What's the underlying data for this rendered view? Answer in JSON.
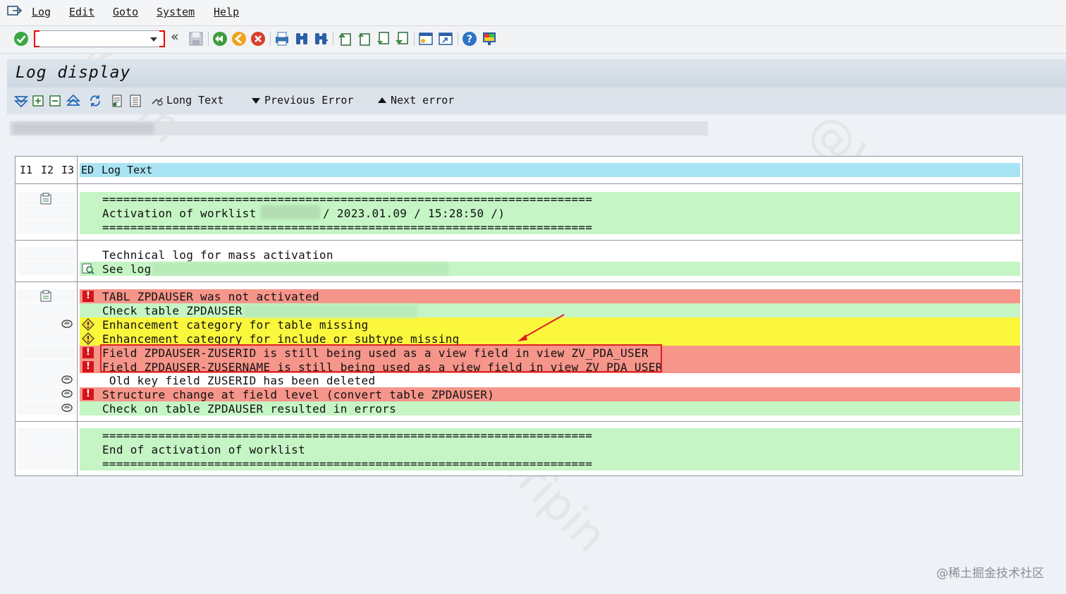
{
  "menu": {
    "items": [
      "Log",
      "Edit",
      "Goto",
      "System",
      "Help"
    ]
  },
  "toolbar": {
    "command_value": "",
    "icons": [
      "enter-icon",
      "back-double-arrow-icon",
      "save-icon",
      "back-icon",
      "exit-icon",
      "cancel-icon",
      "print-icon",
      "find-icon",
      "find-next-icon",
      "first-page-icon",
      "previous-page-icon",
      "next-page-icon",
      "last-page-icon",
      "create-session-icon",
      "shortcut-icon",
      "help-icon",
      "layout-menu-icon"
    ]
  },
  "page": {
    "title": "Log display"
  },
  "app_toolbar": {
    "long_text": "Long Text",
    "previous_error": "Previous Error",
    "next_error": "Next error"
  },
  "table": {
    "headers": [
      "I1",
      "I2",
      "I3",
      "ED",
      "Log Text"
    ],
    "rows": [
      {
        "text": "======================================================================",
        "color": "green"
      },
      {
        "text": "Activation of worklist",
        "suffix": "/ 2023.01.09 / 15:28:50 /)",
        "color": "green"
      },
      {
        "text": "======================================================================",
        "color": "green"
      },
      {
        "text": "Technical log for mass activation",
        "color": "white"
      },
      {
        "text": "See log",
        "color": "green"
      },
      {
        "text": "TABL ZPDAUSER was not activated",
        "color": "red"
      },
      {
        "text": "Check table ZPDAUSER",
        "color": "green"
      },
      {
        "text": "Enhancement category for table missing",
        "color": "yellow"
      },
      {
        "text": "Enhancement category for include or subtype missing",
        "color": "yellow"
      },
      {
        "text": "Field ZPDAUSER-ZUSERID is still being used as a view field in view ZV_PDA_USER",
        "color": "red"
      },
      {
        "text": "Field ZPDAUSER-ZUSERNAME is still being used as a view field in view ZV_PDA_USER",
        "color": "red"
      },
      {
        "text": " Old key field ZUSERID has been deleted",
        "color": "white"
      },
      {
        "text": "Structure change at field level (convert table ZPDAUSER)",
        "color": "red"
      },
      {
        "text": "Check on table ZPDAUSER resulted in errors",
        "color": "green"
      },
      {
        "text": "======================================================================",
        "color": "green"
      },
      {
        "text": "End of activation of worklist",
        "color": "green"
      },
      {
        "text": "======================================================================",
        "color": "green"
      }
    ]
  },
  "colors": {
    "green": "#c5f5c5",
    "red": "#f6958a",
    "yellow": "#fbf73c",
    "header": "#a9e4f4",
    "error_icon": "#d4141a"
  },
  "watermark": "@稀土掘金技术社区"
}
